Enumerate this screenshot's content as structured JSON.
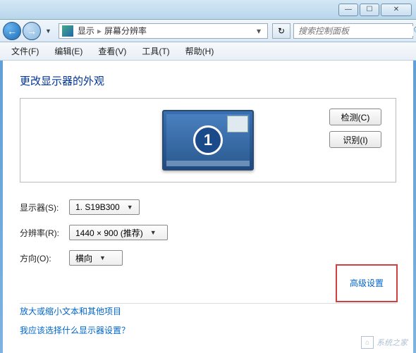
{
  "titlebar": {
    "minimize": "—",
    "maximize": "☐",
    "close": "✕"
  },
  "nav": {
    "back": "←",
    "forward": "→",
    "breadcrumb": {
      "root": "显示",
      "current": "屏幕分辨率"
    },
    "refresh": "↻",
    "search_placeholder": "搜索控制面板",
    "search_icon": "🔍"
  },
  "menubar": {
    "file": "文件(F)",
    "edit": "编辑(E)",
    "view": "查看(V)",
    "tools": "工具(T)",
    "help": "帮助(H)"
  },
  "page": {
    "title": "更改显示器的外观",
    "monitor_number": "1",
    "detect_btn": "检测(C)",
    "identify_btn": "识别(I)"
  },
  "form": {
    "display_label": "显示器(S):",
    "display_value": "1. S19B300",
    "resolution_label": "分辨率(R):",
    "resolution_value": "1440 × 900 (推荐)",
    "orientation_label": "方向(O):",
    "orientation_value": "横向"
  },
  "links": {
    "advanced": "高级设置",
    "text_size": "放大或缩小文本和其他项目",
    "which_display": "我应该选择什么显示器设置？"
  },
  "watermark": "系统之家"
}
